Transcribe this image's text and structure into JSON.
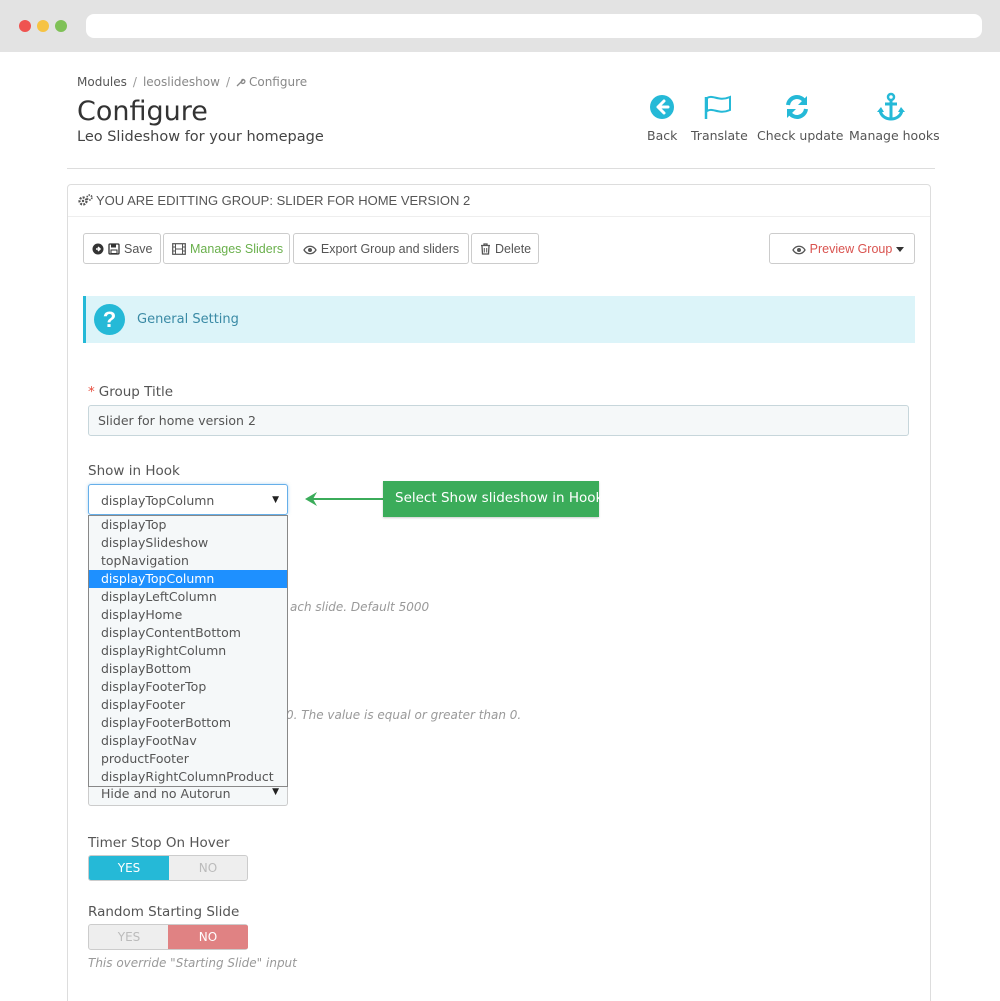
{
  "breadcrumb": {
    "items": [
      "Modules",
      "leoslideshow",
      "Configure"
    ]
  },
  "header": {
    "title": "Configure",
    "subtitle": "Leo Slideshow for your homepage"
  },
  "toolbar": {
    "back": "Back",
    "translate": "Translate",
    "check_update": "Check update",
    "manage_hooks": "Manage hooks",
    "icon_color": "#25b9d7"
  },
  "panel": {
    "heading": "YOU ARE EDITTING GROUP: SLIDER FOR HOME VERSION 2",
    "buttons": {
      "save": "Save",
      "manage_sliders": "Manages Sliders",
      "export": "Export Group and sliders",
      "delete": "Delete",
      "preview": "Preview Group"
    },
    "info": "General Setting"
  },
  "form": {
    "group_title_label": "Group Title",
    "group_title_value": "Slider for home version 2",
    "hook_label": "Show in Hook",
    "hook_value": "displayTopColumn",
    "hook_options": [
      "displayTop",
      "displaySlideshow",
      "topNavigation",
      "displayTopColumn",
      "displayLeftColumn",
      "displayHome",
      "displayContentBottom",
      "displayRightColumn",
      "displayBottom",
      "displayFooterTop",
      "displayFooter",
      "displayFooterBottom",
      "displayFootNav",
      "productFooter",
      "displayRightColumnProduct"
    ],
    "hint_delay": "ach slide. Default 5000",
    "hint_value": "0. The value is equal or greater than 0.",
    "navigator_value": "Hide and no Autorun",
    "timer_label": "Timer Stop On Hover",
    "timer_yes": "YES",
    "timer_no": "NO",
    "random_label": "Random Starting Slide",
    "random_yes": "YES",
    "random_no": "NO",
    "random_hint": "This override \"Starting Slide\" input"
  },
  "callout": {
    "text": "Select Show slideshow in Hook",
    "color": "#3bac5a"
  }
}
